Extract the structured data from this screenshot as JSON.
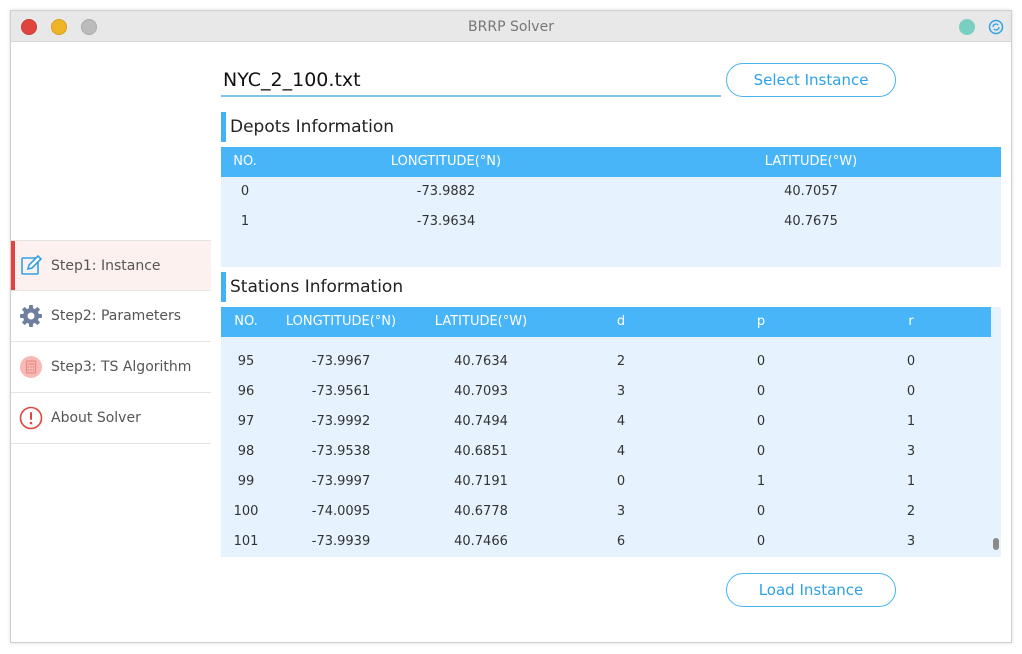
{
  "window": {
    "title": "BRRP Solver",
    "colors": {
      "close": "#e0443e",
      "minimize": "#f0b526",
      "maximize": "#bcbcbc",
      "accent": "#48b5f8"
    }
  },
  "sidebar": {
    "items": [
      {
        "label": "Step1: Instance",
        "icon": "edit-icon",
        "active": true
      },
      {
        "label": "Step2: Parameters",
        "icon": "gear-icon"
      },
      {
        "label": "Step3: TS Algorithm",
        "icon": "calculator-icon"
      },
      {
        "label": "About Solver",
        "icon": "info-circle-icon"
      }
    ]
  },
  "instance": {
    "file_value": "NYC_2_100.txt",
    "select_label": "Select Instance",
    "load_label": "Load Instance"
  },
  "depots": {
    "title": "Depots Information",
    "headers": [
      "NO.",
      "LONGTITUDE(°N)",
      "LATITUDE(°W)"
    ],
    "rows": [
      [
        "0",
        "-73.9882",
        "40.7057"
      ],
      [
        "1",
        "-73.9634",
        "40.7675"
      ]
    ]
  },
  "stations": {
    "title": "Stations Information",
    "headers": [
      "NO.",
      "LONGTITUDE(°N)",
      "LATITUDE(°W)",
      "d",
      "p",
      "r"
    ],
    "rows": [
      [
        "95",
        "-73.9967",
        "40.7634",
        "2",
        "0",
        "0"
      ],
      [
        "96",
        "-73.9561",
        "40.7093",
        "3",
        "0",
        "0"
      ],
      [
        "97",
        "-73.9992",
        "40.7494",
        "4",
        "0",
        "1"
      ],
      [
        "98",
        "-73.9538",
        "40.6851",
        "4",
        "0",
        "3"
      ],
      [
        "99",
        "-73.9997",
        "40.7191",
        "0",
        "1",
        "1"
      ],
      [
        "100",
        "-74.0095",
        "40.6778",
        "3",
        "0",
        "2"
      ],
      [
        "101",
        "-73.9939",
        "40.7466",
        "6",
        "0",
        "3"
      ]
    ],
    "scroll_position": 0.97
  }
}
